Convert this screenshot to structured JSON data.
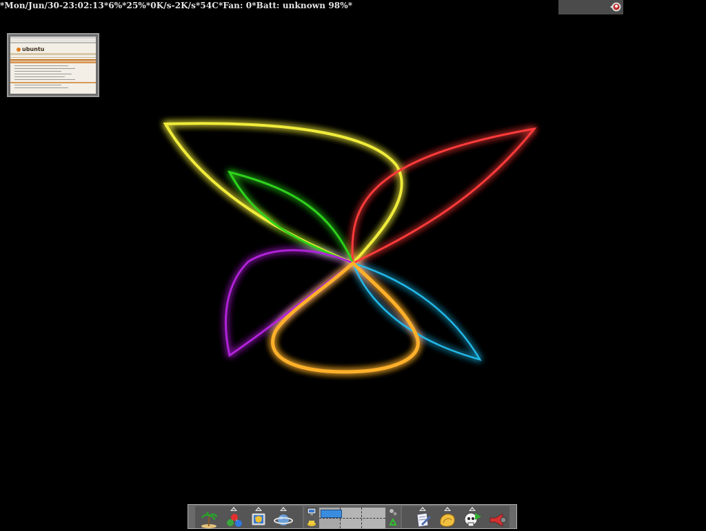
{
  "status": {
    "text": "*Mon/Jun/30-23:02:13*6%*25%*0K/s-2K/s*54C*Fan: 0*Batt: unknown 98%*"
  },
  "thumbnail": {
    "logo_text": "ubuntu"
  },
  "colors": {
    "yellow": "#f0ec3a",
    "red": "#ff3a3a",
    "green": "#2fd21f",
    "cyan": "#23b8e8",
    "purple": "#b020d8",
    "orange": "#ffb02a"
  },
  "panel": {
    "left_launchers": [
      {
        "name": "palm-tree-icon"
      },
      {
        "name": "molecule-icon"
      },
      {
        "name": "monitor-shield-icon"
      },
      {
        "name": "planet-icon"
      }
    ],
    "right_launchers": [
      {
        "name": "document-pen-icon"
      },
      {
        "name": "shell-icon"
      },
      {
        "name": "skull-play-icon"
      },
      {
        "name": "megaphone-icon"
      }
    ]
  }
}
